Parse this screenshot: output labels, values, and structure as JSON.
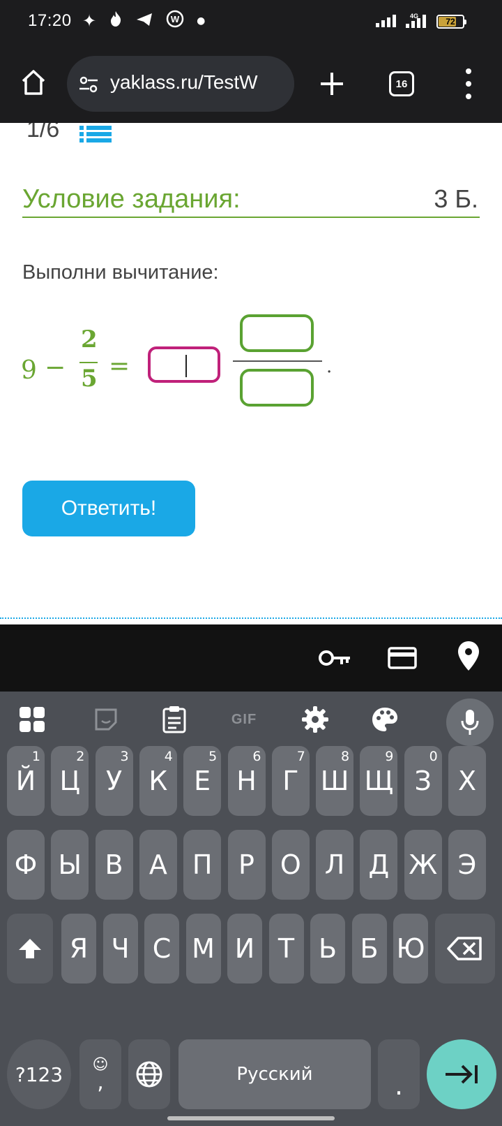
{
  "status_bar": {
    "time": "17:20",
    "battery": "72",
    "network": "4G"
  },
  "browser": {
    "url": "yaklass.ru/TestW",
    "tab_count": "16"
  },
  "page": {
    "progress": "1/6",
    "task_title": "Условие задания:",
    "points": "3 Б.",
    "instruction": "Выполни вычитание:",
    "expression": {
      "whole": "9",
      "minus": "−",
      "numerator": "2",
      "denominator": "5",
      "equals": "=",
      "end": "."
    },
    "answer_button": "Ответить!"
  },
  "keyboard": {
    "toolbar": [
      "apps-icon",
      "sticker-icon",
      "clipboard-icon",
      "gif-icon",
      "settings-icon",
      "palette-icon",
      "mic-icon"
    ],
    "gif_label": "GIF",
    "row1": [
      {
        "ch": "Й",
        "hint": "1"
      },
      {
        "ch": "Ц",
        "hint": "2"
      },
      {
        "ch": "У",
        "hint": "3"
      },
      {
        "ch": "К",
        "hint": "4"
      },
      {
        "ch": "Е",
        "hint": "5"
      },
      {
        "ch": "Н",
        "hint": "6"
      },
      {
        "ch": "Г",
        "hint": "7"
      },
      {
        "ch": "Ш",
        "hint": "8"
      },
      {
        "ch": "Щ",
        "hint": "9"
      },
      {
        "ch": "З",
        "hint": "0"
      },
      {
        "ch": "Х",
        "hint": ""
      }
    ],
    "row2": [
      "Ф",
      "Ы",
      "В",
      "А",
      "П",
      "Р",
      "О",
      "Л",
      "Д",
      "Ж",
      "Э"
    ],
    "row3": [
      "Я",
      "Ч",
      "С",
      "М",
      "И",
      "Т",
      "Ь",
      "Б",
      "Ю"
    ],
    "symbols_key": "?123",
    "comma_key": ",",
    "space_label": "Русский",
    "period_key": "."
  }
}
